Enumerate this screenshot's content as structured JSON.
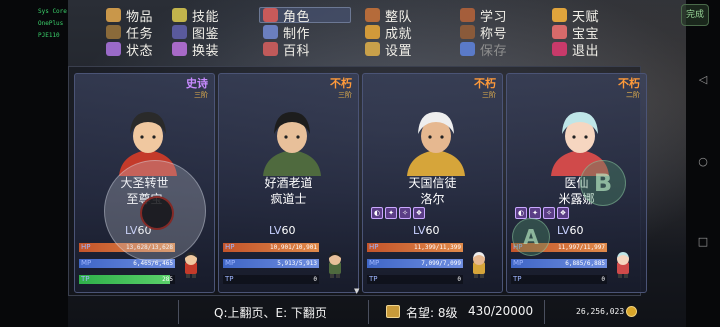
{
  "system": {
    "labels": [
      "Sys Core",
      "OnePlus",
      "PJE110"
    ]
  },
  "menu": {
    "rows": [
      [
        {
          "label": "物品",
          "icon": "bag-icon",
          "color": "#c9974a"
        },
        {
          "label": "技能",
          "icon": "skill-icon",
          "color": "#c2b44c"
        },
        {
          "label": "角色",
          "icon": "character-icon",
          "color": "#c85a5a",
          "active": true
        },
        {
          "label": "整队",
          "icon": "team-icon",
          "color": "#b56b3a"
        },
        {
          "label": "学习",
          "icon": "book-icon",
          "color": "#a55e3b"
        },
        {
          "label": "天赋",
          "icon": "talent-icon",
          "color": "#e0a43c"
        }
      ],
      [
        {
          "label": "任务",
          "icon": "quest-icon",
          "color": "#8a6a3a"
        },
        {
          "label": "图鉴",
          "icon": "codex-icon",
          "color": "#5a5a9c"
        },
        {
          "label": "制作",
          "icon": "craft-icon",
          "color": "#6b7fbf"
        },
        {
          "label": "成就",
          "icon": "trophy-icon",
          "color": "#d29a3a"
        },
        {
          "label": "称号",
          "icon": "title-icon",
          "color": "#8a5a3a"
        },
        {
          "label": "宝宝",
          "icon": "pet-icon",
          "color": "#d76a6a"
        }
      ],
      [
        {
          "label": "状态",
          "icon": "status-icon",
          "color": "#9a6ac8"
        },
        {
          "label": "换装",
          "icon": "outfit-icon",
          "color": "#a86ac8"
        },
        {
          "label": "百科",
          "icon": "encyclopedia-icon",
          "color": "#c05a5a"
        },
        {
          "label": "设置",
          "icon": "gear-icon",
          "color": "#c8a04a"
        },
        {
          "label": "保存",
          "icon": "save-icon",
          "color": "#5a7ac8",
          "dim": true
        },
        {
          "label": "退出",
          "icon": "exit-icon",
          "color": "#c83a6a"
        }
      ]
    ],
    "done_label": "完成"
  },
  "heroes": [
    {
      "rarity": "史诗",
      "rarity_color": "#c88bff",
      "tier": "三阶",
      "name1": "大圣转世",
      "name2": "至尊宝",
      "skills": [],
      "level_prefix": "LV",
      "level": "60",
      "hp_label": "HP",
      "hp_text": "13,628/13,628",
      "hp_fraction": 1.0,
      "mp_label": "MP",
      "mp_text": "6,465/6,465",
      "mp_fraction": 1.0,
      "tp_label": "TP",
      "tp_text": "285",
      "tp_fraction": 0.95,
      "hair": "#2a2a2a",
      "outfit": "#c43a2a",
      "skin": "#f0c8a0"
    },
    {
      "rarity": "不朽",
      "rarity_color": "#ff9a3a",
      "tier": "三阶",
      "name1": "好酒老道",
      "name2": "疯道士",
      "skills": [],
      "level_prefix": "LV",
      "level": "60",
      "hp_label": "HP",
      "hp_text": "10,901/10,901",
      "hp_fraction": 1.0,
      "mp_label": "MP",
      "mp_text": "5,913/5,913",
      "mp_fraction": 1.0,
      "tp_label": "TP",
      "tp_text": "0",
      "tp_fraction": 0,
      "hair": "#1d1d1d",
      "outfit": "#4f6a3e",
      "skin": "#e8c09a"
    },
    {
      "rarity": "不朽",
      "rarity_color": "#ff9a3a",
      "tier": "三阶",
      "name1": "天国信徒",
      "name2": "洛尔",
      "skills": [
        "◐",
        "✦",
        "✧",
        "❖"
      ],
      "level_prefix": "LV",
      "level": "60",
      "hp_label": "HP",
      "hp_text": "11,399/11,399",
      "hp_fraction": 1.0,
      "mp_label": "MP",
      "mp_text": "7,099/7,099",
      "mp_fraction": 1.0,
      "tp_label": "TP",
      "tp_text": "0",
      "tp_fraction": 0,
      "hair": "#eeeeee",
      "outfit": "#d6a53a",
      "skin": "#e6b890"
    },
    {
      "rarity": "不朽",
      "rarity_color": "#ff9a3a",
      "tier": "二阶",
      "name1": "医仙",
      "name2": "米露娜",
      "skills": [
        "◐",
        "✦",
        "✧",
        "❖"
      ],
      "level_prefix": "LV",
      "level": "60",
      "hp_label": "HP",
      "hp_text": "11,997/11,997",
      "hp_fraction": 1.0,
      "mp_label": "MP",
      "mp_text": "6,885/6,885",
      "mp_fraction": 1.0,
      "tp_label": "TP",
      "tp_text": "0",
      "tp_fraction": 0,
      "hair": "#bfe6e8",
      "outfit": "#d04a4a",
      "skin": "#f6d6c0"
    }
  ],
  "controls": {
    "a_label": "A",
    "b_label": "B"
  },
  "footer": {
    "pager": "Q:上翻页、E: 下翻页",
    "reputation_label": "名望: 8级",
    "reputation_progress": "430/20000",
    "gold": "26,256,023",
    "scroll_arrow": "▼"
  },
  "colors": {
    "hp": "#c4542a",
    "mp": "#3f66c6",
    "tp": "#2fb04a"
  }
}
